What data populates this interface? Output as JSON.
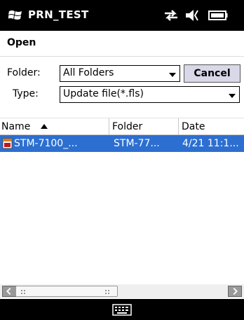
{
  "status_bar": {
    "app_title": "PRN_TEST",
    "icons": [
      "windows-logo-icon",
      "connectivity-icon",
      "volume-icon",
      "battery-icon"
    ]
  },
  "header": {
    "title": "Open"
  },
  "form": {
    "folder_label": "Folder:",
    "folder_value": "All Folders",
    "cancel_label": "Cancel",
    "type_label": "Type:",
    "type_value": "Update file(*.fls)"
  },
  "list": {
    "columns": [
      "Name",
      "Folder",
      "Date"
    ],
    "sort_column": "Name",
    "sort_direction": "ascending",
    "rows": [
      {
        "name": "STM-7100_...",
        "folder": "STM-77...",
        "date": "4/21 11:1...",
        "icon": "update-file-icon",
        "selected": true
      }
    ]
  },
  "bottom_bar": {
    "icon": "keyboard-icon"
  },
  "colors": {
    "selection": "#2c6fd1",
    "cancel_button": "#d9d8e8",
    "bars": "#000000"
  }
}
